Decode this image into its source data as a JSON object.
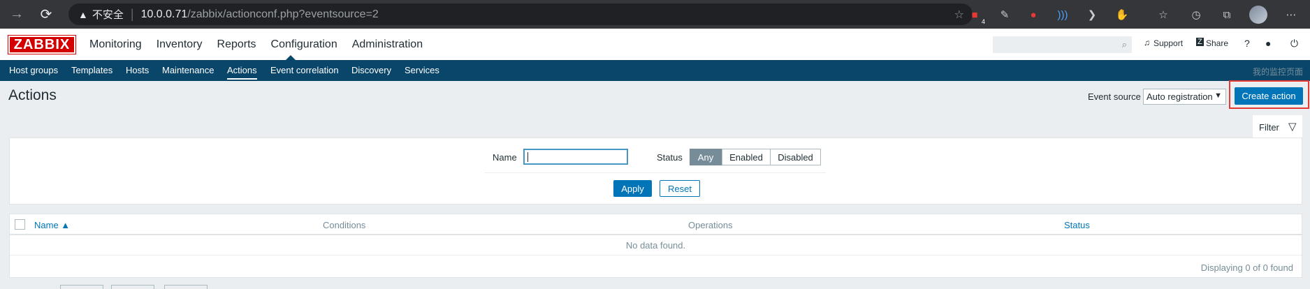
{
  "browser": {
    "insecure_label": "不安全",
    "url_host": "10.0.0.71",
    "url_path": "/zabbix/actionconf.php?eventsource=2",
    "ext_badge": "4"
  },
  "header": {
    "logo": "ZABBIX",
    "main_menu": [
      "Monitoring",
      "Inventory",
      "Reports",
      "Configuration",
      "Administration"
    ],
    "support": "Support",
    "share": "Share",
    "help": "?"
  },
  "submenu": {
    "items": [
      "Host groups",
      "Templates",
      "Hosts",
      "Maintenance",
      "Actions",
      "Event correlation",
      "Discovery",
      "Services"
    ],
    "right_text": "我的监控页面"
  },
  "page": {
    "title": "Actions",
    "event_source_label": "Event source",
    "event_source_value": "Auto registration",
    "create_button": "Create action"
  },
  "filter": {
    "tab_label": "Filter",
    "name_label": "Name",
    "name_value": "",
    "status_label": "Status",
    "status_options": [
      "Any",
      "Enabled",
      "Disabled"
    ],
    "status_selected": "Any",
    "apply": "Apply",
    "reset": "Reset"
  },
  "table": {
    "columns": [
      "Name ▲",
      "Conditions",
      "Operations",
      "Status"
    ],
    "empty": "No data found.",
    "footer": "Displaying 0 of 0 found"
  }
}
